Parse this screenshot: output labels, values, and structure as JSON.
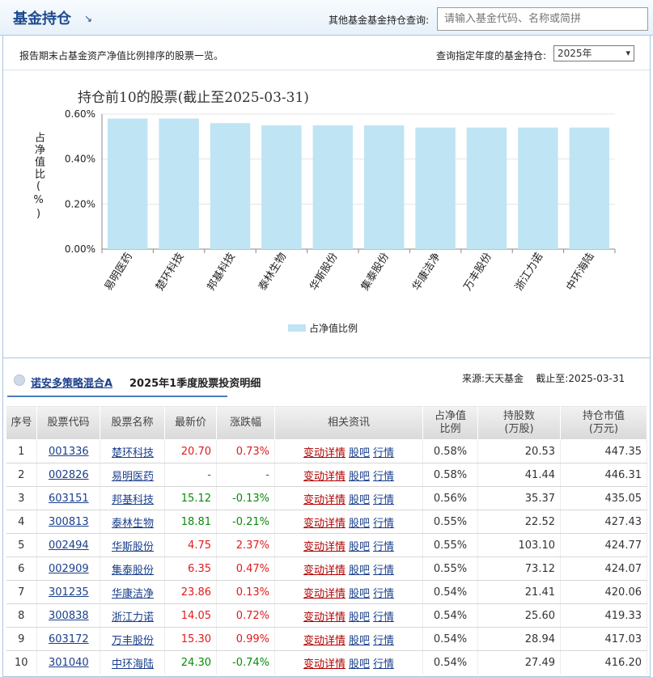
{
  "header": {
    "title": "基金持仓",
    "title_arrow": "↘",
    "search_label": "其他基金基金持仓查询:",
    "search_placeholder": "请输入基金代码、名称或简拼"
  },
  "toolbar": {
    "description": "报告期末占基金资产净值比例排序的股票一览。",
    "year_label": "查询指定年度的基金持仓:",
    "year_selected": "2025年",
    "year_caret": "▾"
  },
  "chart_data": {
    "type": "bar",
    "title": "持仓前10的股票(截止至2025-03-31)",
    "ylabel": "占净值比(%)",
    "ylim": [
      0,
      0.6
    ],
    "yticks": [
      "0.00%",
      "0.20%",
      "0.40%",
      "0.60%"
    ],
    "categories": [
      "易明医药",
      "楚环科技",
      "邦基科技",
      "泰林生物",
      "华斯股份",
      "集泰股份",
      "华康洁净",
      "万丰股份",
      "浙江力诺",
      "中环海陆"
    ],
    "series": [
      {
        "name": "占净值比例",
        "values": [
          0.58,
          0.58,
          0.56,
          0.55,
          0.55,
          0.55,
          0.54,
          0.54,
          0.54,
          0.54
        ]
      }
    ],
    "legend_position": "bottom",
    "bar_color": "#bfe4f4",
    "grid": true
  },
  "section": {
    "fund_name": "诺安多策略混合A",
    "title": "2025年1季度股票投资明细",
    "source": "来源:天天基金    截止至:2025-03-31"
  },
  "table": {
    "headers": {
      "idx": "序号",
      "code": "股票代码",
      "name": "股票名称",
      "price": "最新价",
      "change": "涨跌幅",
      "news": "相关资讯",
      "ratio_1": "占净值",
      "ratio_2": "比例",
      "shares_1": "持股数",
      "shares_2": "(万股)",
      "value_1": "持仓市值",
      "value_2": "(万元)"
    },
    "links": {
      "detail": "变动详情",
      "bar": "股吧",
      "quote": "行情"
    },
    "rows": [
      {
        "idx": "1",
        "code": "001336",
        "name": "楚环科技",
        "price": "20.70",
        "change": "0.73%",
        "dir": "up",
        "ratio": "0.58%",
        "shares": "20.53",
        "value": "447.35"
      },
      {
        "idx": "2",
        "code": "002826",
        "name": "易明医药",
        "price": "-",
        "change": "-",
        "dir": "flat",
        "ratio": "0.58%",
        "shares": "41.44",
        "value": "446.31"
      },
      {
        "idx": "3",
        "code": "603151",
        "name": "邦基科技",
        "price": "15.12",
        "change": "-0.13%",
        "dir": "down",
        "ratio": "0.56%",
        "shares": "35.37",
        "value": "435.05"
      },
      {
        "idx": "4",
        "code": "300813",
        "name": "泰林生物",
        "price": "18.81",
        "change": "-0.21%",
        "dir": "down",
        "ratio": "0.55%",
        "shares": "22.52",
        "value": "427.43"
      },
      {
        "idx": "5",
        "code": "002494",
        "name": "华斯股份",
        "price": "4.75",
        "change": "2.37%",
        "dir": "up",
        "ratio": "0.55%",
        "shares": "103.10",
        "value": "424.77"
      },
      {
        "idx": "6",
        "code": "002909",
        "name": "集泰股份",
        "price": "6.35",
        "change": "0.47%",
        "dir": "up",
        "ratio": "0.55%",
        "shares": "73.12",
        "value": "424.07"
      },
      {
        "idx": "7",
        "code": "301235",
        "name": "华康洁净",
        "price": "23.86",
        "change": "0.13%",
        "dir": "up",
        "ratio": "0.54%",
        "shares": "21.41",
        "value": "420.06"
      },
      {
        "idx": "8",
        "code": "300838",
        "name": "浙江力诺",
        "price": "14.05",
        "change": "0.72%",
        "dir": "up",
        "ratio": "0.54%",
        "shares": "25.60",
        "value": "419.33"
      },
      {
        "idx": "9",
        "code": "603172",
        "name": "万丰股份",
        "price": "15.30",
        "change": "0.99%",
        "dir": "up",
        "ratio": "0.54%",
        "shares": "28.94",
        "value": "417.03"
      },
      {
        "idx": "10",
        "code": "301040",
        "name": "中环海陆",
        "price": "24.30",
        "change": "-0.74%",
        "dir": "down",
        "ratio": "0.54%",
        "shares": "27.49",
        "value": "416.20"
      }
    ]
  }
}
